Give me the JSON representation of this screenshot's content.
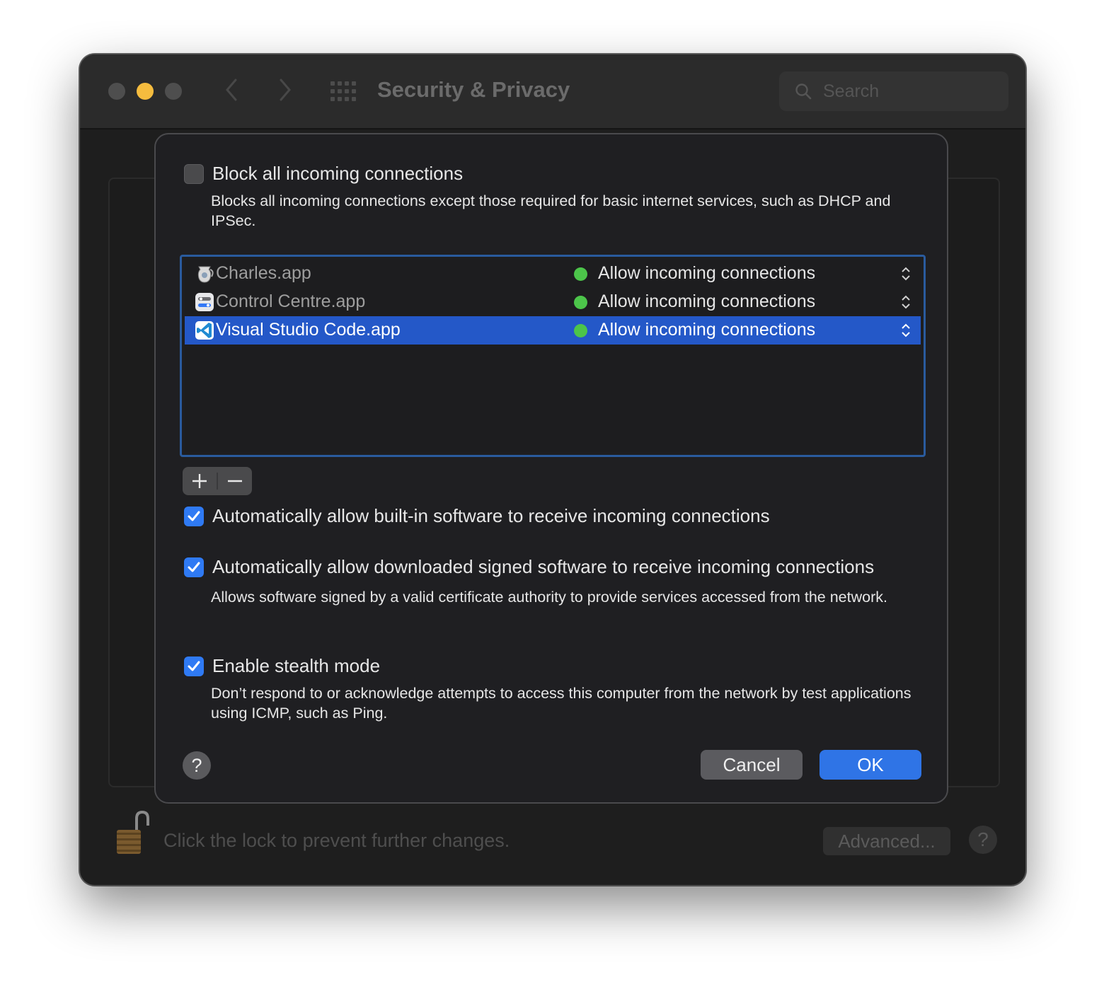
{
  "window": {
    "title": "Security & Privacy",
    "search_placeholder": "Search",
    "lock_text": "Click the lock to prevent further changes.",
    "advanced_label": "Advanced...",
    "help_label": "?"
  },
  "sheet": {
    "block_all": {
      "label": "Block all incoming connections",
      "checked": false,
      "description": "Blocks all incoming connections except those required for basic internet services, such as DHCP and IPSec."
    },
    "apps": [
      {
        "name": "Charles.app",
        "status": "Allow incoming connections",
        "status_color": "#4cc54a",
        "selected": false,
        "icon": "charles-jug-icon"
      },
      {
        "name": "Control Centre.app",
        "status": "Allow incoming connections",
        "status_color": "#4cc54a",
        "selected": false,
        "icon": "control-centre-icon"
      },
      {
        "name": "Visual Studio Code.app",
        "status": "Allow incoming connections",
        "status_color": "#4cc54a",
        "selected": true,
        "icon": "vscode-icon"
      }
    ],
    "add_label": "+",
    "remove_label": "−",
    "auto_builtin": {
      "label": "Automatically allow built-in software to receive incoming connections",
      "checked": true
    },
    "auto_signed": {
      "label": "Automatically allow downloaded signed software to receive incoming connections",
      "checked": true,
      "description": "Allows software signed by a valid certificate authority to provide services accessed from the network."
    },
    "stealth": {
      "label": "Enable stealth mode",
      "checked": true,
      "description": "Don’t respond to or acknowledge attempts to access this computer from the network by test applications using ICMP, such as Ping."
    },
    "help_label": "?",
    "cancel_label": "Cancel",
    "ok_label": "OK"
  },
  "colors": {
    "accent": "#2f74e6",
    "selection": "#2458c8",
    "status_green": "#4cc54a",
    "traffic_yellow": "#f5bc3e"
  }
}
